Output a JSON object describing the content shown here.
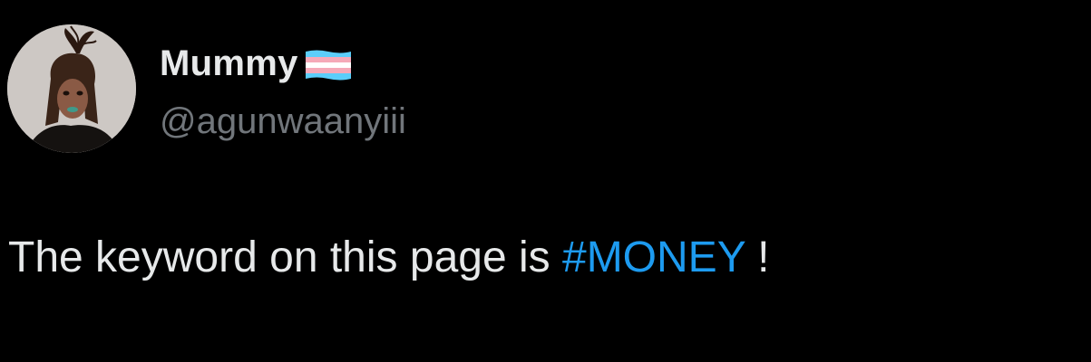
{
  "author": {
    "display_name": "Mummy",
    "handle": "@agunwaanyiii",
    "name_emoji": "transgender-flag-icon"
  },
  "tweet": {
    "text_before": "The keyword on this page is ",
    "hashtag": "#MONEY",
    "text_after": " !"
  },
  "colors": {
    "background": "#000000",
    "primary_text": "#e7e9ea",
    "secondary_text": "#71767b",
    "link": "#1d9bf0",
    "flag_blue": "#5bcefa",
    "flag_pink": "#f5a9b8",
    "flag_white": "#ffffff"
  }
}
